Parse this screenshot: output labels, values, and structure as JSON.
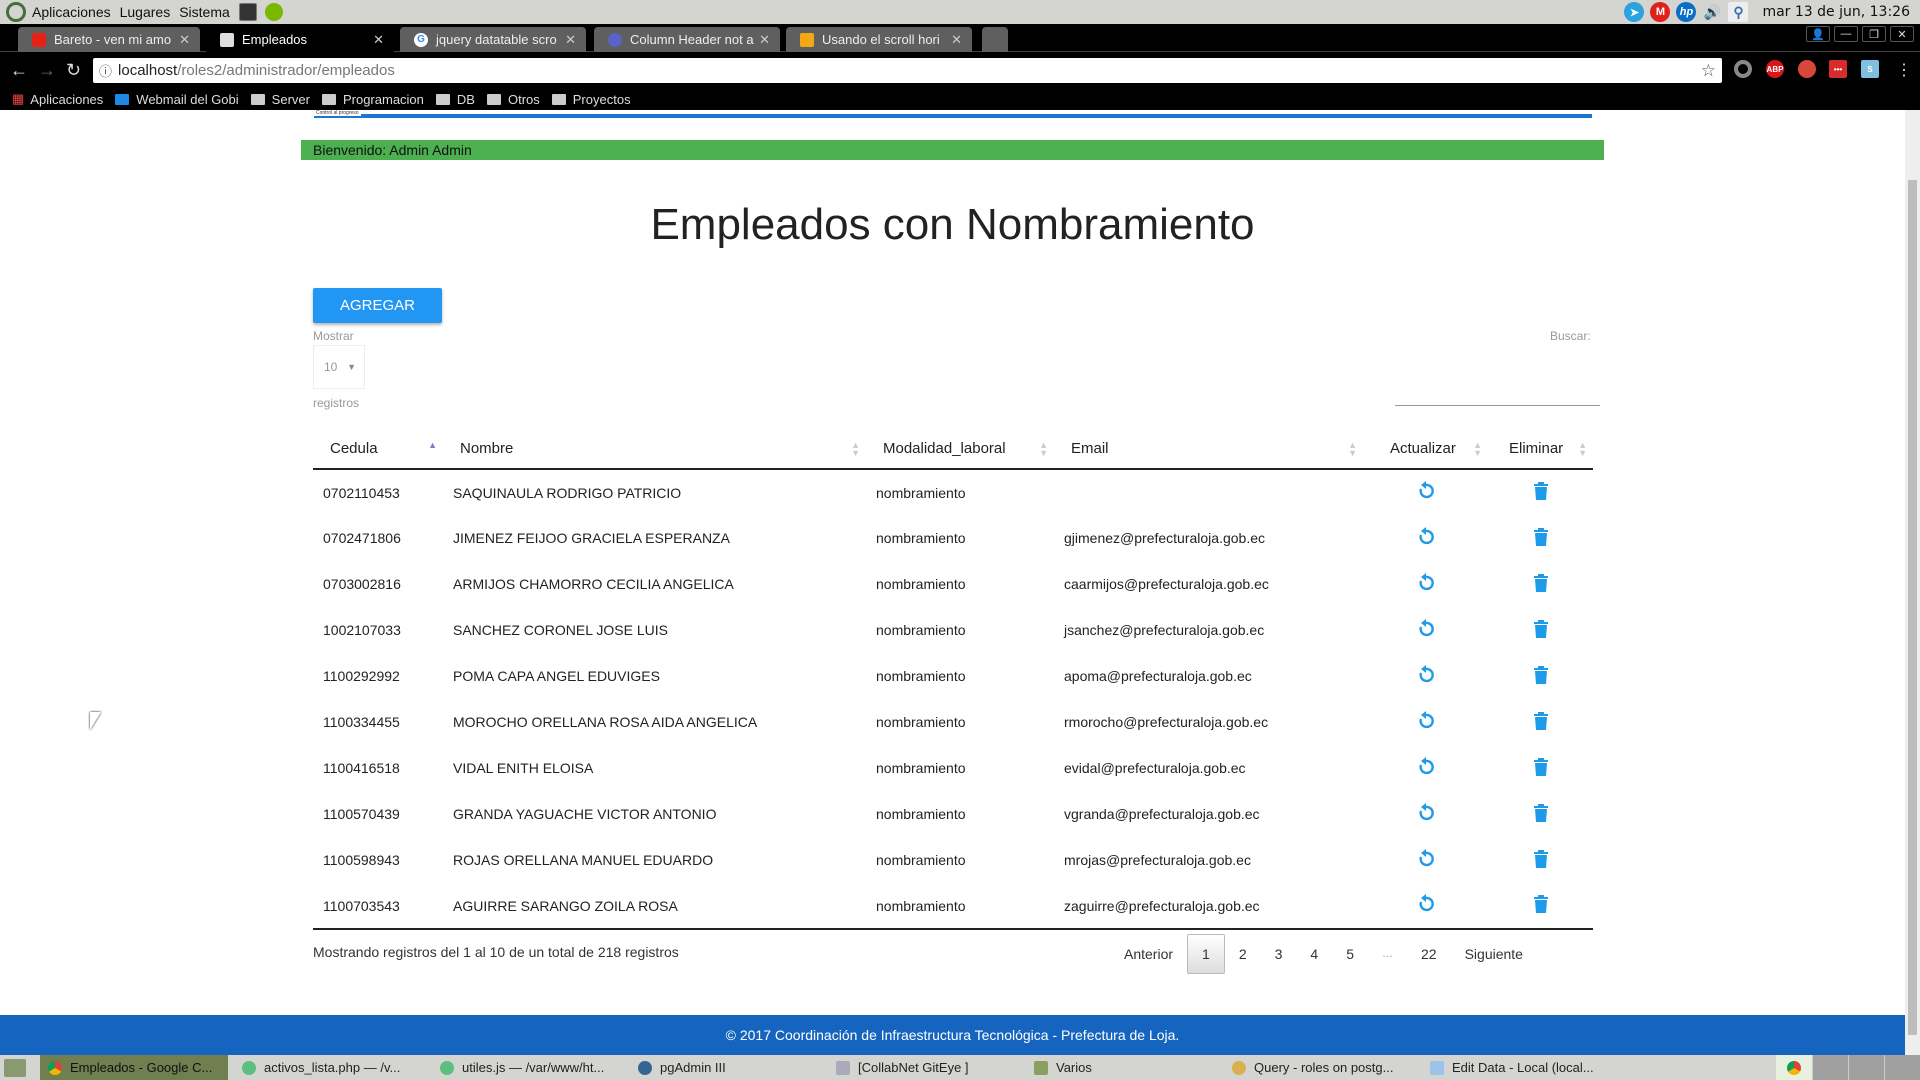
{
  "system_bar": {
    "menus": [
      "Aplicaciones",
      "Lugares",
      "Sistema"
    ],
    "clock": "mar 13 de jun, 13:26"
  },
  "browser": {
    "tabs": [
      {
        "label": "Bareto - ven mi amo",
        "icon": "youtube-icon",
        "active": false
      },
      {
        "label": "Empleados",
        "icon": "page-icon",
        "active": true
      },
      {
        "label": "jquery datatable scro",
        "icon": "google-icon",
        "active": false
      },
      {
        "label": "Column Header not a",
        "icon": "stackexchange-icon",
        "active": false
      },
      {
        "label": "Usando el scroll hori",
        "icon": "stackoverflow-icon",
        "active": false
      }
    ],
    "url_host": "localhost",
    "url_path": "/roles2/administrador/empleados",
    "extensions": [
      "ABP"
    ],
    "bookmarks": [
      "Aplicaciones",
      "Webmail del Gobi",
      "Server",
      "Programacion",
      "DB",
      "Otros",
      "Proyectos"
    ]
  },
  "page": {
    "top_stripe_label": "Control al progreso",
    "welcome": "Bienvenido: Admin Admin",
    "title": "Empleados con Nombramiento",
    "add_button": "AGREGAR",
    "show_label": "Mostrar",
    "page_size": "10",
    "records_label": "registros",
    "search_label": "Buscar:",
    "accent_color": "#2196f3",
    "welcome_color": "#4caf50",
    "footer_color": "#1565c0"
  },
  "table": {
    "columns": [
      "Cedula",
      "Nombre",
      "Modalidad_laboral",
      "Email",
      "Actualizar",
      "Eliminar"
    ],
    "sorted_column": "Cedula",
    "sort_direction": "asc",
    "rows": [
      {
        "cedula": "0702110453",
        "nombre": "SAQUINAULA RODRIGO PATRICIO",
        "modalidad": "nombramiento",
        "email": ""
      },
      {
        "cedula": "0702471806",
        "nombre": "JIMENEZ FEIJOO GRACIELA ESPERANZA",
        "modalidad": "nombramiento",
        "email": "gjimenez@prefecturaloja.gob.ec"
      },
      {
        "cedula": "0703002816",
        "nombre": "ARMIJOS CHAMORRO CECILIA ANGELICA",
        "modalidad": "nombramiento",
        "email": "caarmijos@prefecturaloja.gob.ec"
      },
      {
        "cedula": "1002107033",
        "nombre": "SANCHEZ CORONEL JOSE LUIS",
        "modalidad": "nombramiento",
        "email": "jsanchez@prefecturaloja.gob.ec"
      },
      {
        "cedula": "1100292992",
        "nombre": "POMA CAPA ANGEL EDUVIGES",
        "modalidad": "nombramiento",
        "email": "apoma@prefecturaloja.gob.ec"
      },
      {
        "cedula": "1100334455",
        "nombre": "MOROCHO ORELLANA ROSA AIDA ANGELICA",
        "modalidad": "nombramiento",
        "email": "rmorocho@prefecturaloja.gob.ec"
      },
      {
        "cedula": "1100416518",
        "nombre": "VIDAL ENITH ELOISA",
        "modalidad": "nombramiento",
        "email": "evidal@prefecturaloja.gob.ec"
      },
      {
        "cedula": "1100570439",
        "nombre": "GRANDA YAGUACHE VICTOR ANTONIO",
        "modalidad": "nombramiento",
        "email": "vgranda@prefecturaloja.gob.ec"
      },
      {
        "cedula": "1100598943",
        "nombre": "ROJAS ORELLANA MANUEL EDUARDO",
        "modalidad": "nombramiento",
        "email": "mrojas@prefecturaloja.gob.ec"
      },
      {
        "cedula": "1100703543",
        "nombre": "AGUIRRE SARANGO ZOILA ROSA",
        "modalidad": "nombramiento",
        "email": "zaguirre@prefecturaloja.gob.ec"
      }
    ],
    "info": "Mostrando registros del 1 al 10 de un total de 218 registros",
    "pagination": {
      "previous": "Anterior",
      "pages": [
        "1",
        "2",
        "3",
        "4",
        "5",
        "…",
        "22"
      ],
      "current": "1",
      "next": "Siguiente"
    }
  },
  "footer": "© 2017 Coordinación de Infraestructura Tecnológica - Prefectura de Loja.",
  "taskbar": {
    "items": [
      {
        "label": "Empleados - Google C...",
        "active": true
      },
      {
        "label": "activos_lista.php — /v...",
        "active": false
      },
      {
        "label": "utiles.js — /var/www/ht...",
        "active": false
      },
      {
        "label": "pgAdmin III",
        "active": false
      },
      {
        "label": "[CollabNet GitEye ]",
        "active": false
      },
      {
        "label": "Varios",
        "active": false
      },
      {
        "label": "Query - roles on postg...",
        "active": false
      },
      {
        "label": "Edit Data - Local (local...",
        "active": false
      }
    ]
  }
}
